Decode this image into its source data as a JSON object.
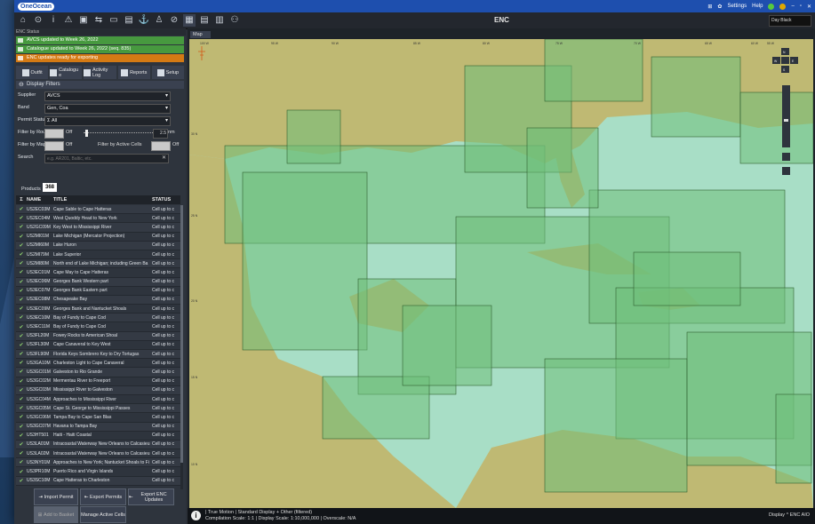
{
  "app": {
    "brand": "OneOcean",
    "settings": "Settings",
    "help": "Help",
    "view_title": "ENC",
    "theme": "Day Black"
  },
  "enc_status": {
    "header": "ENC Status",
    "items": [
      {
        "text": "AVCS updated to Week 26, 2022",
        "kind": "ok"
      },
      {
        "text": "Catalogue updated to Week 26, 2022 (seq. 835)",
        "kind": "ok"
      },
      {
        "text": "ENC updates ready for exporting",
        "kind": "warn"
      }
    ]
  },
  "tabs": [
    {
      "label": "Outfit"
    },
    {
      "label": "Catalogu e"
    },
    {
      "label": "Activity Log"
    },
    {
      "label": "Reports"
    },
    {
      "label": "Setup"
    }
  ],
  "filters": {
    "header": "Display Filters",
    "supplier_label": "Supplier",
    "supplier_value": "AVCS",
    "band_label": "Band",
    "band_value": "Gen, Coa",
    "permit_label": "Permit Status",
    "permit_value": "All",
    "route_label": "Filter by Route",
    "route_state": "Off",
    "route_nm": "2.5",
    "route_unit": "nm",
    "map_label": "Filter by Map",
    "map_state": "Off",
    "active_label": "Filter by Active Cells",
    "active_state": "Off",
    "search_label": "Search",
    "search_placeholder": "e.g. AR201, Baltic, etc."
  },
  "products": {
    "label": "Products",
    "count": "368",
    "columns": {
      "sigma": "Σ",
      "name": "NAME",
      "title": "TITLE",
      "status": "STATUS"
    },
    "rows": [
      {
        "name": "US2EC03M",
        "title": "Cape Sable to Cape Hatteras",
        "status": "Cell up to c"
      },
      {
        "name": "US2EC04M",
        "title": "West Quoddy Head to New York",
        "status": "Cell up to c"
      },
      {
        "name": "US2GC09M",
        "title": "Key West to Mississippi River",
        "status": "Cell up to c"
      },
      {
        "name": "US2MI01M",
        "title": "Lake Michigan (Mercator Projection)",
        "status": "Cell up to c"
      },
      {
        "name": "US2MI60M",
        "title": "Lake Huron",
        "status": "Cell up to c"
      },
      {
        "name": "US2MI79M",
        "title": "Lake Superior",
        "status": "Cell up to c"
      },
      {
        "name": "US2MI80M",
        "title": "North end of Lake Michigan; including Green Ba",
        "status": "Cell up to c"
      },
      {
        "name": "US3EC01M",
        "title": "Cape May to Cape Hatteras",
        "status": "Cell up to c"
      },
      {
        "name": "US3EC06M",
        "title": "Georges Bank Western part",
        "status": "Cell up to c"
      },
      {
        "name": "US3EC07M",
        "title": "Georges Bank Eastern part",
        "status": "Cell up to c"
      },
      {
        "name": "US3EC08M",
        "title": "Chesapeake Bay",
        "status": "Cell up to c"
      },
      {
        "name": "US3EC09M",
        "title": "Georges Bank and Nantucket Shoals",
        "status": "Cell up to c"
      },
      {
        "name": "US3EC10M",
        "title": "Bay of Fundy to Cape Cod",
        "status": "Cell up to c"
      },
      {
        "name": "US3EC11M",
        "title": "Bay of Fundy to Cape Cod",
        "status": "Cell up to c"
      },
      {
        "name": "US3FL20M",
        "title": "Fowey Rocks to American Shoal",
        "status": "Cell up to c"
      },
      {
        "name": "US3FL30M",
        "title": "Cape Canaveral to Key West",
        "status": "Cell up to c"
      },
      {
        "name": "US3FL90M",
        "title": "Florida Keys Sombrero Key to Dry Tortugas",
        "status": "Cell up to c"
      },
      {
        "name": "US3GA10M",
        "title": "Charleston Light to Cape Canaveral",
        "status": "Cell up to c"
      },
      {
        "name": "US3GC01M",
        "title": "Galveston to Rio Grande",
        "status": "Cell up to c"
      },
      {
        "name": "US3GC02M",
        "title": "Mermentau River to Freeport",
        "status": "Cell up to c"
      },
      {
        "name": "US3GC03M",
        "title": "Mississippi River to Galveston",
        "status": "Cell up to c"
      },
      {
        "name": "US3GC04M",
        "title": "Approaches to Mississippi River",
        "status": "Cell up to c"
      },
      {
        "name": "US3GC05M",
        "title": "Cape St. George to Mississippi Passes",
        "status": "Cell up to c"
      },
      {
        "name": "US3GC06M",
        "title": "Tampa Bay to Cape San Blas",
        "status": "Cell up to c"
      },
      {
        "name": "US3GC07M",
        "title": "Havana to Tampa Bay",
        "status": "Cell up to c"
      },
      {
        "name": "US3HT501",
        "title": "Haiti - Haiti Coastal",
        "status": "Cell up to c"
      },
      {
        "name": "US3LA01M",
        "title": "Intracoastal Waterway New Orleans to Calcasieu",
        "status": "Cell up to c"
      },
      {
        "name": "US3LA02M",
        "title": "Intracoastal Waterway New Orleans to Calcasieu",
        "status": "Cell up to c"
      },
      {
        "name": "US3NY01M",
        "title": "Approaches to New York; Nantucket Shoals to Fi",
        "status": "Cell up to c"
      },
      {
        "name": "US3PR10M",
        "title": "Puerto Rico and Virgin Islands",
        "status": "Cell up to c"
      },
      {
        "name": "US3SC10M",
        "title": "Cape Hatteras to Charleston",
        "status": "Cell up to c"
      }
    ]
  },
  "actions": {
    "import_permit": "Import Permit",
    "export_permits": "Export Permits",
    "export_enc": "Export ENC Updates",
    "add_to_basket": "Add to Basket",
    "manage_cells": "Manage Active Cells"
  },
  "map": {
    "tab": "Map",
    "longitudes": [
      "100 W",
      "95 W",
      "90 W",
      "85 W",
      "80 W",
      "75 W",
      "70 W",
      "65 W",
      "60 W",
      "55 W"
    ],
    "latitudes": [
      "30 N",
      "25 N",
      "20 N",
      "15 N",
      "10 N"
    ],
    "status_line1": "| True Motion | Standard Display + Other (filtered)",
    "status_line2": "Compilation Scale: 1:1 | Display Scale: 1:10,000,000 | Overscale: N/A",
    "status_right": "Display ^  ENC  AIO",
    "compass": {
      "n": "N",
      "w": "W",
      "e": "E",
      "s": "S"
    },
    "colors": {
      "sea": "#a8dec6",
      "land": "#bfb973",
      "cell": "#6fc07a"
    }
  }
}
